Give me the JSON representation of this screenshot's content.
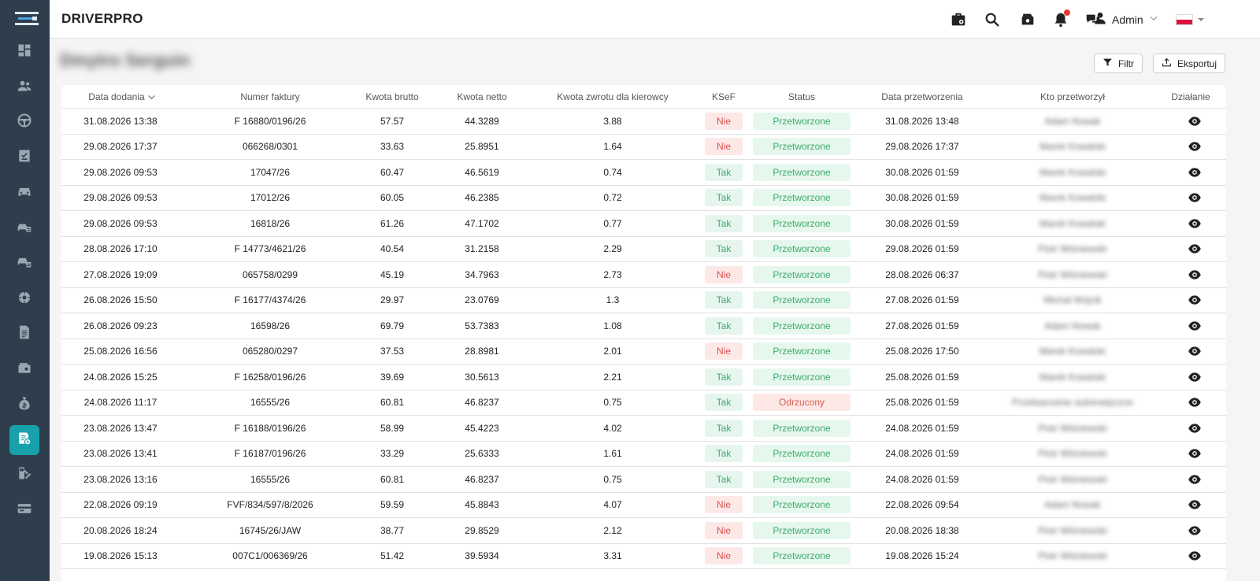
{
  "app": {
    "brand": "DRIVERPRO"
  },
  "header": {
    "user": "Admin",
    "language_flag": "pl"
  },
  "page": {
    "title": "Dmytro Serguin"
  },
  "toolbar": {
    "filter_label": "Filtr",
    "export_label": "Eksportuj"
  },
  "sidebar": {
    "items": [
      {
        "icon": "dashboard-icon"
      },
      {
        "icon": "users-icon"
      },
      {
        "icon": "steering-wheel-icon"
      },
      {
        "icon": "checklist-icon"
      },
      {
        "icon": "car-icon"
      },
      {
        "icon": "car-service-icon"
      },
      {
        "icon": "car-list-icon"
      },
      {
        "icon": "settings-cog-icon"
      },
      {
        "icon": "document-icon"
      },
      {
        "icon": "wallet-icon"
      },
      {
        "icon": "money-bag-icon"
      },
      {
        "icon": "invoice-refund-icon",
        "active": true
      },
      {
        "icon": "fuel-tools-icon"
      },
      {
        "icon": "credit-card-icon"
      }
    ]
  },
  "table": {
    "columns": [
      "Data dodania",
      "Numer faktury",
      "Kwota brutto",
      "Kwota netto",
      "Kwota zwrotu dla kierowcy",
      "KSeF",
      "Status",
      "Data przetworzenia",
      "Kto przetworzył",
      "Działanie"
    ],
    "rows": [
      {
        "date_added": "31.08.2026 13:38",
        "invoice": "F 16880/0196/26",
        "gross": "57.57",
        "net": "44.3289",
        "refund": "3.88",
        "ksef": "Nie",
        "status": "Przetworzone",
        "processed": "31.08.2026 13:48",
        "processed_by": "Adam Nowak"
      },
      {
        "date_added": "29.08.2026 17:37",
        "invoice": "066268/0301",
        "gross": "33.63",
        "net": "25.8951",
        "refund": "1.64",
        "ksef": "Nie",
        "status": "Przetworzone",
        "processed": "29.08.2026 17:37",
        "processed_by": "Marek Kowalski"
      },
      {
        "date_added": "29.08.2026 09:53",
        "invoice": "17047/26",
        "gross": "60.47",
        "net": "46.5619",
        "refund": "0.74",
        "ksef": "Tak",
        "status": "Przetworzone",
        "processed": "30.08.2026 01:59",
        "processed_by": "Marek Kowalski"
      },
      {
        "date_added": "29.08.2026 09:53",
        "invoice": "17012/26",
        "gross": "60.05",
        "net": "46.2385",
        "refund": "0.72",
        "ksef": "Tak",
        "status": "Przetworzone",
        "processed": "30.08.2026 01:59",
        "processed_by": "Marek Kowalski"
      },
      {
        "date_added": "29.08.2026 09:53",
        "invoice": "16818/26",
        "gross": "61.26",
        "net": "47.1702",
        "refund": "0.77",
        "ksef": "Tak",
        "status": "Przetworzone",
        "processed": "30.08.2026 01:59",
        "processed_by": "Marek Kowalski"
      },
      {
        "date_added": "28.08.2026 17:10",
        "invoice": "F 14773/4621/26",
        "gross": "40.54",
        "net": "31.2158",
        "refund": "2.29",
        "ksef": "Tak",
        "status": "Przetworzone",
        "processed": "29.08.2026 01:59",
        "processed_by": "Piotr Wiśniewski"
      },
      {
        "date_added": "27.08.2026 19:09",
        "invoice": "065758/0299",
        "gross": "45.19",
        "net": "34.7963",
        "refund": "2.73",
        "ksef": "Nie",
        "status": "Przetworzone",
        "processed": "28.08.2026 06:37",
        "processed_by": "Piotr Wiśniewski"
      },
      {
        "date_added": "26.08.2026 15:50",
        "invoice": "F 16177/4374/26",
        "gross": "29.97",
        "net": "23.0769",
        "refund": "1.3",
        "ksef": "Tak",
        "status": "Przetworzone",
        "processed": "27.08.2026 01:59",
        "processed_by": "Michał Wójcik"
      },
      {
        "date_added": "26.08.2026 09:23",
        "invoice": "16598/26",
        "gross": "69.79",
        "net": "53.7383",
        "refund": "1.08",
        "ksef": "Tak",
        "status": "Przetworzone",
        "processed": "27.08.2026 01:59",
        "processed_by": "Adam Nowak"
      },
      {
        "date_added": "25.08.2026 16:56",
        "invoice": "065280/0297",
        "gross": "37.53",
        "net": "28.8981",
        "refund": "2.01",
        "ksef": "Nie",
        "status": "Przetworzone",
        "processed": "25.08.2026 17:50",
        "processed_by": "Marek Kowalski"
      },
      {
        "date_added": "24.08.2026 15:25",
        "invoice": "F 16258/0196/26",
        "gross": "39.69",
        "net": "30.5613",
        "refund": "2.21",
        "ksef": "Tak",
        "status": "Przetworzone",
        "processed": "25.08.2026 01:59",
        "processed_by": "Marek Kowalski"
      },
      {
        "date_added": "24.08.2026 11:17",
        "invoice": "16555/26",
        "gross": "60.81",
        "net": "46.8237",
        "refund": "0.75",
        "ksef": "Tak",
        "status": "Odrzucony",
        "processed": "25.08.2026 01:59",
        "processed_by": "Przetwarzanie automatyczne"
      },
      {
        "date_added": "23.08.2026 13:47",
        "invoice": "F 16188/0196/26",
        "gross": "58.99",
        "net": "45.4223",
        "refund": "4.02",
        "ksef": "Tak",
        "status": "Przetworzone",
        "processed": "24.08.2026 01:59",
        "processed_by": "Piotr Wiśniewski"
      },
      {
        "date_added": "23.08.2026 13:41",
        "invoice": "F 16187/0196/26",
        "gross": "33.29",
        "net": "25.6333",
        "refund": "1.61",
        "ksef": "Tak",
        "status": "Przetworzone",
        "processed": "24.08.2026 01:59",
        "processed_by": "Piotr Wiśniewski"
      },
      {
        "date_added": "23.08.2026 13:16",
        "invoice": "16555/26",
        "gross": "60.81",
        "net": "46.8237",
        "refund": "0.75",
        "ksef": "Tak",
        "status": "Przetworzone",
        "processed": "24.08.2026 01:59",
        "processed_by": "Piotr Wiśniewski"
      },
      {
        "date_added": "22.08.2026 09:19",
        "invoice": "FVF/834/597/8/2026",
        "gross": "59.59",
        "net": "45.8843",
        "refund": "4.07",
        "ksef": "Nie",
        "status": "Przetworzone",
        "processed": "22.08.2026 09:54",
        "processed_by": "Adam Nowak"
      },
      {
        "date_added": "20.08.2026 18:24",
        "invoice": "16745/26/JAW",
        "gross": "38.77",
        "net": "29.8529",
        "refund": "2.12",
        "ksef": "Nie",
        "status": "Przetworzone",
        "processed": "20.08.2026 18:38",
        "processed_by": "Piotr Wiśniewski"
      },
      {
        "date_added": "19.08.2026 15:13",
        "invoice": "007C1/006369/26",
        "gross": "51.42",
        "net": "39.5934",
        "refund": "3.31",
        "ksef": "Nie",
        "status": "Przetworzone",
        "processed": "19.08.2026 15:24",
        "processed_by": "Piotr Wiśniewski"
      }
    ]
  },
  "colors": {
    "sidebar_bg": "#2f3e4c",
    "accent": "#18a0ab",
    "status_ok": "#3dab6a",
    "status_rejected": "#d8604f"
  }
}
